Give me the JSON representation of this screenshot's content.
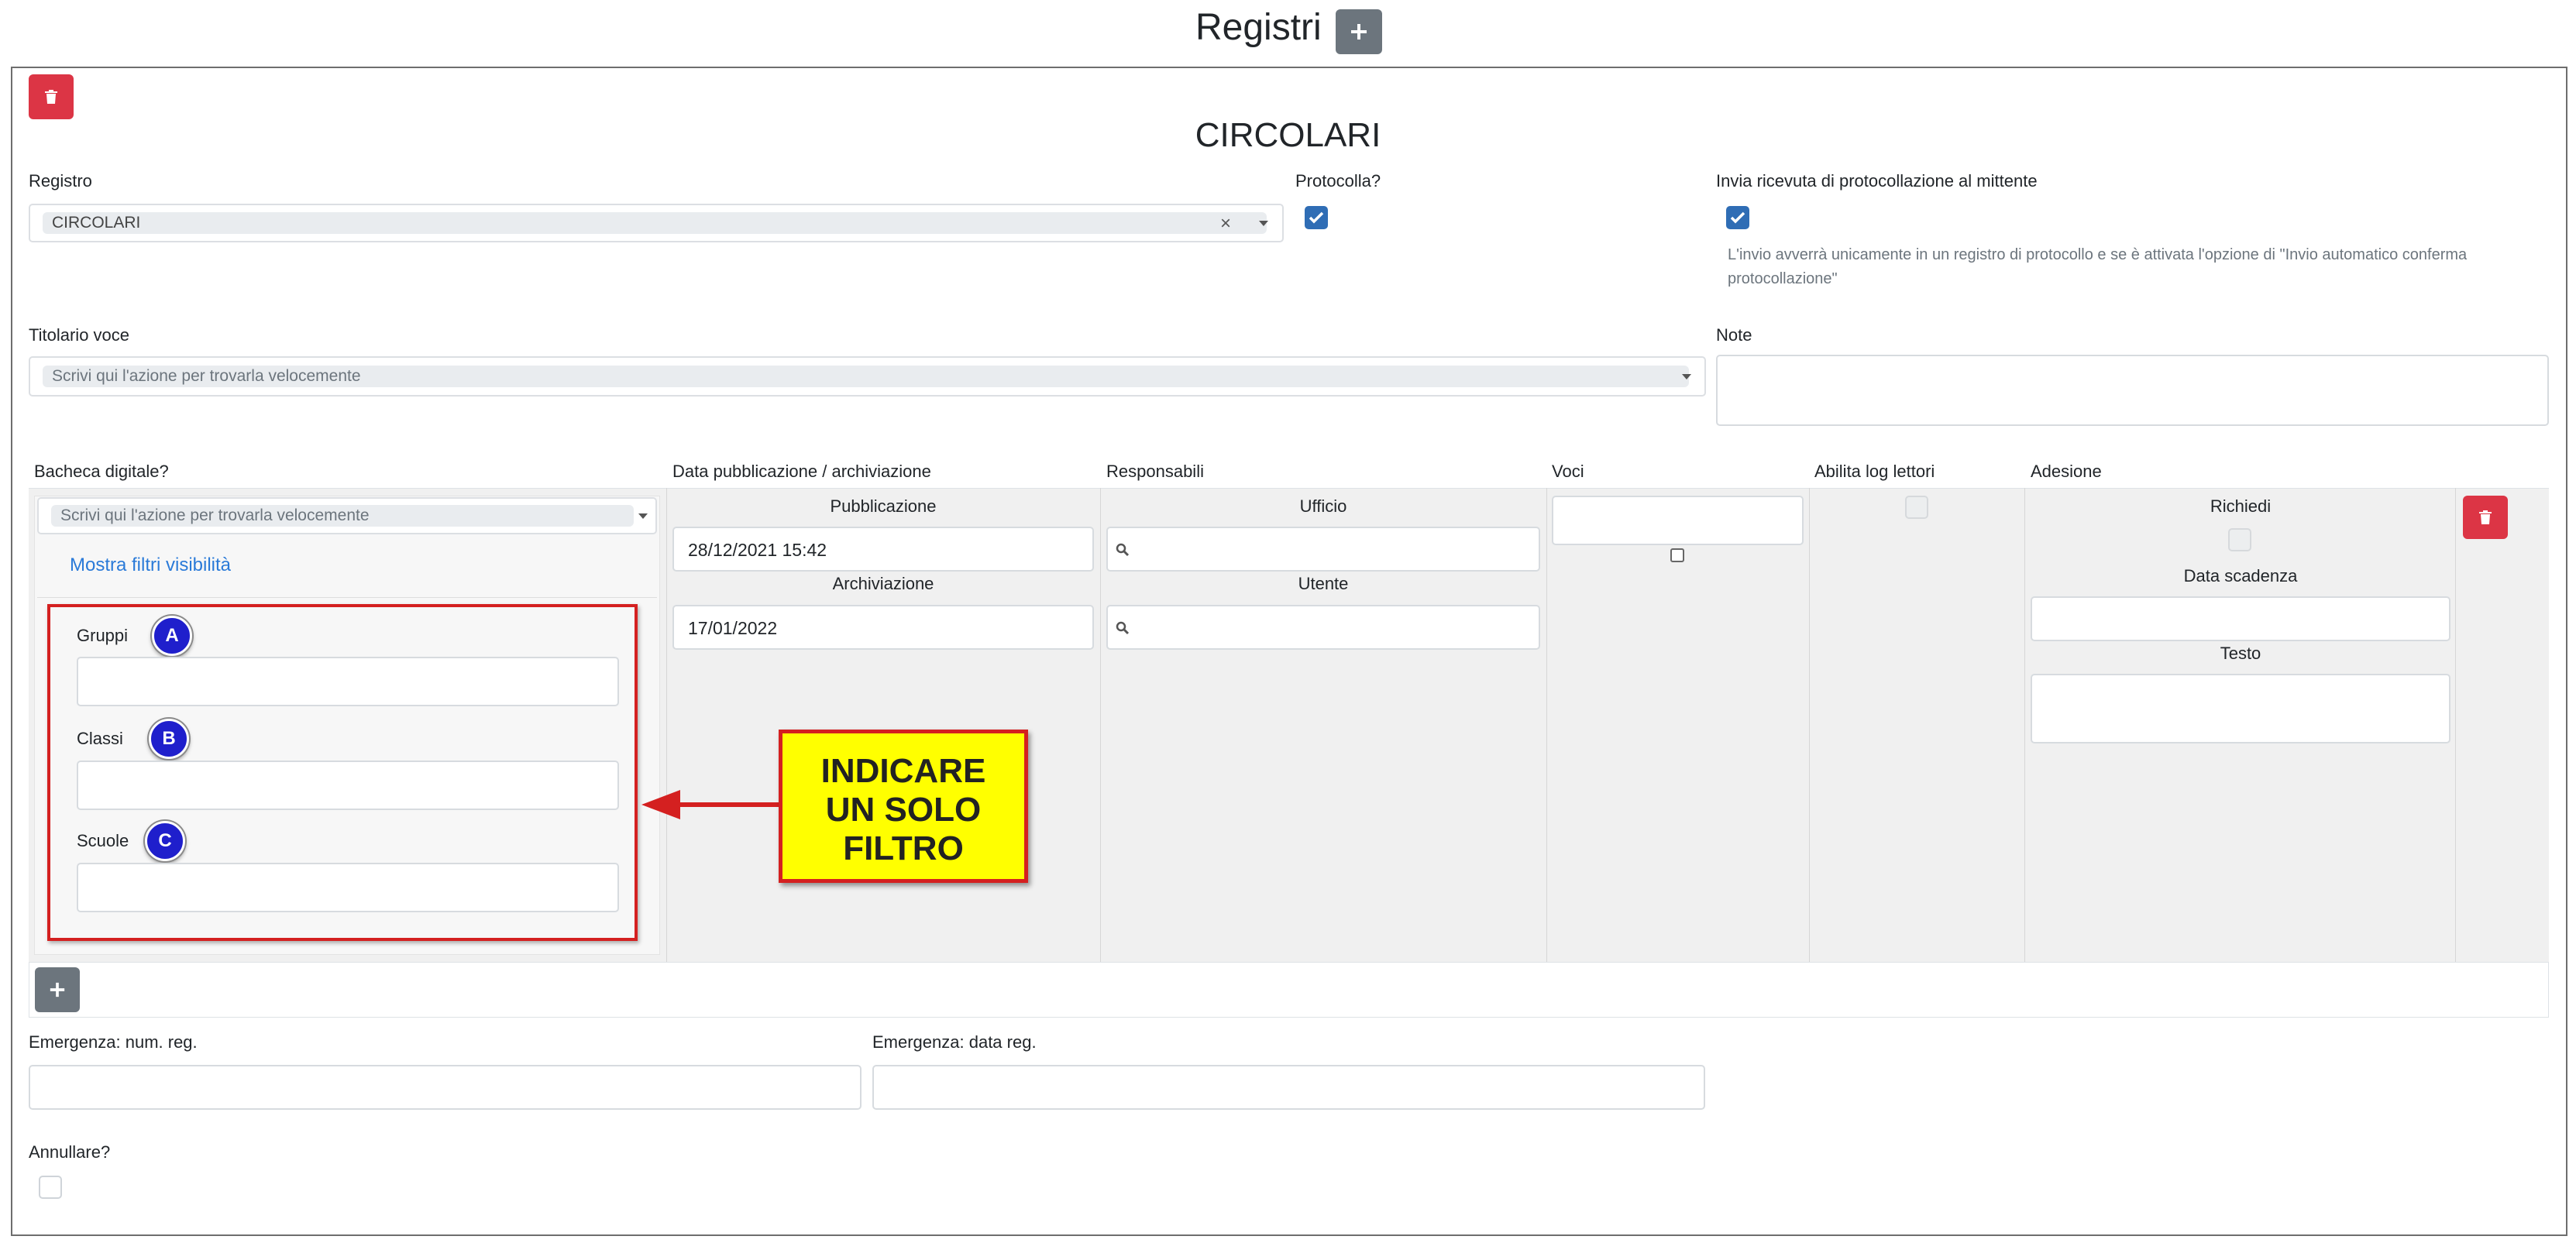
{
  "page_title": "Registri",
  "section_title": "CIRCOLARI",
  "registro": {
    "label": "Registro",
    "value": "CIRCOLARI",
    "clear_glyph": "×"
  },
  "protocolla": {
    "label": "Protocolla?",
    "checked": true
  },
  "invia_ricevuta": {
    "label": "Invia ricevuta di protocollazione al mittente",
    "checked": true,
    "help_text": "L'invio avverrà unicamente in un registro di protocollo e se è attivata l'opzione di \"Invio automatico conferma protocollazione\""
  },
  "titolario": {
    "label": "Titolario voce",
    "placeholder": "Scrivi qui l'azione per trovarla velocemente"
  },
  "note": {
    "label": "Note",
    "value": ""
  },
  "table": {
    "headers": {
      "bacheca": "Bacheca digitale?",
      "data": "Data pubblicazione / archiviazione",
      "responsabili": "Responsabili",
      "voci": "Voci",
      "abilita_log": "Abilita log lettori",
      "adesione": "Adesione"
    },
    "bacheca": {
      "placeholder": "Scrivi qui l'azione per trovarla velocemente",
      "show_filters": "Mostra filtri visibilità",
      "filters": [
        {
          "label": "Gruppi",
          "badge": "A"
        },
        {
          "label": "Classi",
          "badge": "B"
        },
        {
          "label": "Scuole",
          "badge": "C"
        }
      ]
    },
    "date": {
      "pubblicazione_label": "Pubblicazione",
      "pubblicazione_value": "28/12/2021 15:42",
      "archiviazione_label": "Archiviazione",
      "archiviazione_value": "17/01/2022"
    },
    "responsabili": {
      "ufficio_label": "Ufficio",
      "utente_label": "Utente"
    },
    "adesione": {
      "richiedi_label": "Richiedi",
      "data_scadenza_label": "Data scadenza",
      "testo_label": "Testo"
    }
  },
  "callout": {
    "lines": [
      "INDICARE",
      "UN SOLO",
      "FILTRO"
    ],
    "fill": "#ffff00",
    "border": "#d42020"
  },
  "emergenza_num": {
    "label": "Emergenza: num. reg."
  },
  "emergenza_data": {
    "label": "Emergenza: data reg."
  },
  "annullare": {
    "label": "Annullare?",
    "checked": false
  },
  "colors": {
    "danger": "#dc3545",
    "secondary": "#6c757d",
    "primary_check": "#2f6db5",
    "link": "#2a7ad8",
    "badge": "#1f1fcc",
    "annotation_red": "#d42020"
  },
  "icons": {
    "add": "plus-icon",
    "delete": "trash-icon",
    "check": "check-icon",
    "search": "magnifier-icon",
    "dropdown": "caret-down-icon"
  }
}
